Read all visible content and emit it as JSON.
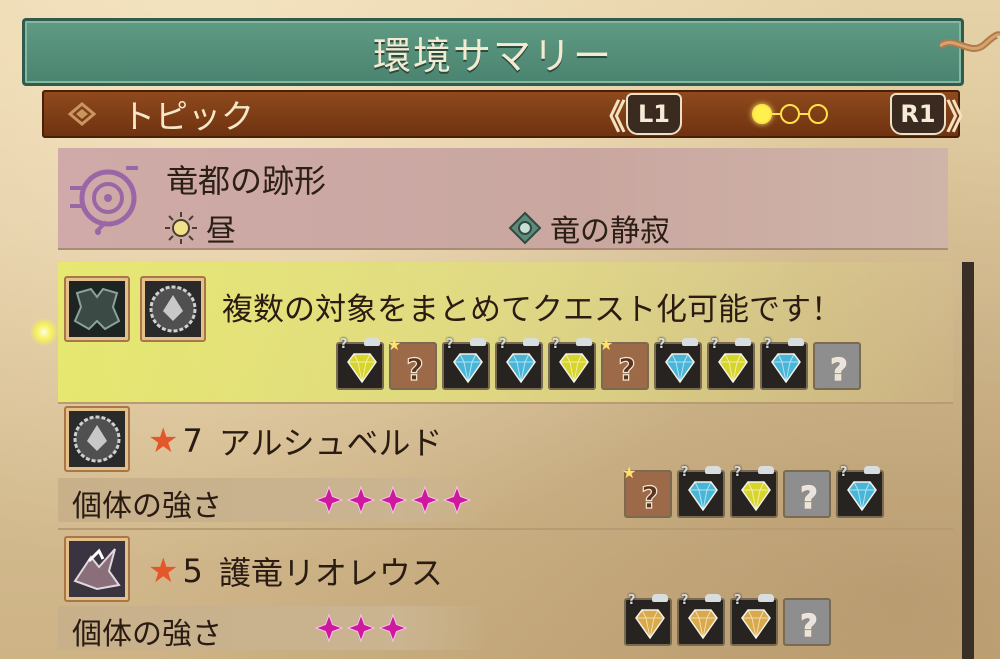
{
  "header": {
    "title": "環境サマリー"
  },
  "topic_bar": {
    "label": "トピック",
    "prev_button": "L1",
    "next_button": "R1",
    "prev_chevron": "《",
    "next_chevron": "》",
    "page_indicator": {
      "total": 3,
      "current": 1
    }
  },
  "location": {
    "name": "竜都の跡形",
    "time_of_day": "昼",
    "environment_state": "竜の静寂"
  },
  "quest_notice": {
    "message": "複数の対象をまとめてクエスト化可能です！",
    "rewards": [
      {
        "kind": "gem",
        "color": "yellow"
      },
      {
        "kind": "unknown",
        "color": "brown",
        "starred": true
      },
      {
        "kind": "gem",
        "color": "blue"
      },
      {
        "kind": "gem",
        "color": "blue"
      },
      {
        "kind": "gem",
        "color": "yellow"
      },
      {
        "kind": "unknown",
        "color": "brown",
        "starred": true
      },
      {
        "kind": "gem",
        "color": "blue"
      },
      {
        "kind": "gem",
        "color": "yellow"
      },
      {
        "kind": "gem",
        "color": "blue"
      },
      {
        "kind": "unknown",
        "color": "gray"
      }
    ]
  },
  "monsters": [
    {
      "rank_label": "7",
      "name": "アルシュベルド",
      "strength_label": "個体の強さ",
      "strength": 5,
      "rewards": [
        {
          "kind": "unknown",
          "color": "brown",
          "starred": true
        },
        {
          "kind": "gem",
          "color": "blue"
        },
        {
          "kind": "gem",
          "color": "yellow"
        },
        {
          "kind": "unknown",
          "color": "gray"
        },
        {
          "kind": "gem",
          "color": "blue"
        }
      ]
    },
    {
      "rank_label": "5",
      "name": "護竜リオレウス",
      "strength_label": "個体の強さ",
      "strength": 3,
      "rewards": [
        {
          "kind": "gem",
          "color": "gold"
        },
        {
          "kind": "gem",
          "color": "gold"
        },
        {
          "kind": "gem",
          "color": "gold"
        },
        {
          "kind": "unknown",
          "color": "gray"
        }
      ]
    }
  ],
  "colors": {
    "gem_yellow": "#d7d52a",
    "gem_blue": "#48b6d8",
    "gem_gold": "#d9a94a",
    "unknown_brown": "#9c6a48",
    "unknown_gray": "#8e8e8e",
    "strength_star": "#d0189e",
    "rank_star": "#e4572a"
  }
}
